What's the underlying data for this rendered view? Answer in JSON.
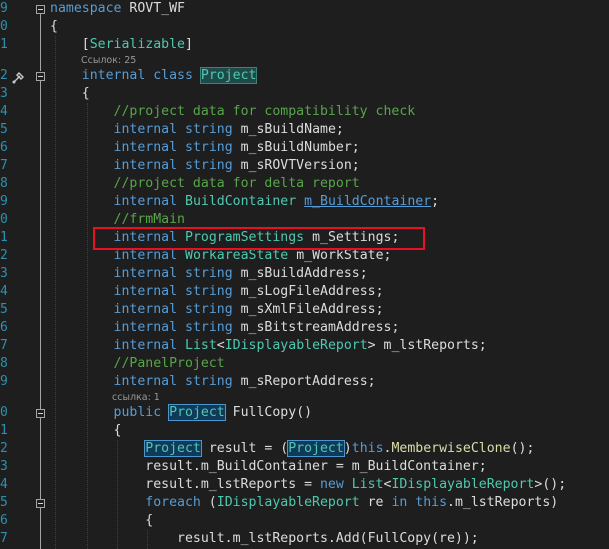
{
  "line_numbers": [
    "9",
    "0",
    "1",
    "",
    "2",
    "3",
    "4",
    "5",
    "6",
    "7",
    "8",
    "9",
    "0",
    "1",
    "2",
    "3",
    "4",
    "5",
    "6",
    "7",
    "8",
    "9",
    "",
    "0",
    "1",
    "2",
    "3",
    "4",
    "5",
    "6",
    "7"
  ],
  "code": {
    "namespace_kw": "namespace",
    "namespace_name": "ROVT_WF",
    "open_brace": "{",
    "attr_open": "[",
    "attr_name": "Serializable",
    "attr_close": "]",
    "lens_refs_25": "Ссылок: 25",
    "class_kw": "internal class",
    "class_name": "Project",
    "comment_compat": "//project data for compatibility check",
    "internal": "internal",
    "string": "string",
    "m_sBuildName": "m_sBuildName;",
    "m_sBuildNumber": "m_sBuildNumber;",
    "m_sROVTVersion": "m_sROVTVersion;",
    "comment_delta": "//project data for delta report",
    "BuildContainer": "BuildContainer",
    "m_BuildContainer": "m_BuildContainer",
    "semicolon": ";",
    "comment_frm": "//frmMain",
    "ProgramSettings": "ProgramSettings",
    "m_Settings": "m_Settings;",
    "WorkareaState": "WorkareaState",
    "m_WorkState": "m_WorkState;",
    "m_sBuildAddress": "m_sBuildAddress;",
    "m_sLogFileAddress": "m_sLogFileAddress;",
    "m_sXmlFileAddress": "m_sXmlFileAddress;",
    "m_sBitstreamAddress": "m_sBitstreamAddress;",
    "List": "List",
    "lt": "<",
    "IDisplayableReport": "IDisplayableReport",
    "gt_reports": "> m_lstReports;",
    "comment_panel": "//PanelProject",
    "m_sReportAddress": "m_sReportAddress;",
    "lens_refs_1": "ссылка: 1",
    "public": "public",
    "Project": "Project",
    "FullCopy_sig": "FullCopy",
    "parens": "()",
    "result_assign": "result = (",
    "close_paren": ")",
    "this": "this",
    "dot": ".",
    "MemberwiseClone": "MemberwiseClone",
    "call_end": "();",
    "line_bc": "result.m_BuildContainer = m_BuildContainer;",
    "line_rep_a": "result.m_lstReports = ",
    "new": "new",
    "rep_end": ">();",
    "foreach": "foreach",
    "foreach_open": " (",
    "re": " re ",
    "in": "in",
    "foreach_tail": ".m_lstReports)",
    "last_line": "result.m_lstReports.Add(FullCopy(re));"
  }
}
